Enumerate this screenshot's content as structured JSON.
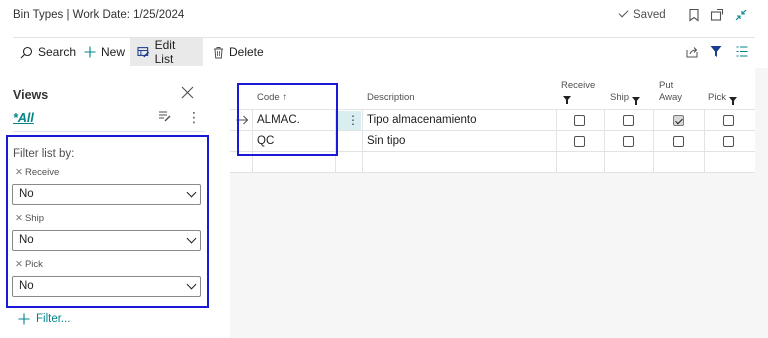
{
  "header": {
    "title": "Bin Types | Work Date: 1/25/2024",
    "saved_label": "Saved"
  },
  "actions": {
    "search": "Search",
    "new": "New",
    "edit_list": "Edit List",
    "delete": "Delete"
  },
  "views": {
    "title": "Views",
    "all_label": "*All",
    "filter_heading": "Filter list by:",
    "filters": [
      {
        "label": "Receive",
        "value": "No"
      },
      {
        "label": "Ship",
        "value": "No"
      },
      {
        "label": "Pick",
        "value": "No"
      }
    ],
    "add_filter": "Filter..."
  },
  "table": {
    "columns": {
      "code": "Code ↑",
      "description": "Description",
      "receive": "Receive",
      "ship": "Ship",
      "put_away_line1": "Put",
      "put_away_line2": "Away",
      "pick": "Pick"
    },
    "rows": [
      {
        "code": "ALMAC.",
        "description": "Tipo almacenamiento",
        "receive": false,
        "ship": false,
        "put_away": true,
        "pick": false
      },
      {
        "code": "QC",
        "description": "Sin tipo",
        "receive": false,
        "ship": false,
        "put_away": false,
        "pick": false
      }
    ]
  },
  "colors": {
    "accent": "#008489",
    "highlight_border": "#1a1ad6",
    "active_row_menu": "#d8eef0"
  },
  "icons": [
    "search-icon",
    "plus-icon",
    "edit-list-icon",
    "trash-icon",
    "bookmark-icon",
    "open-new-window-icon",
    "collapse-icon",
    "share-icon",
    "filter-icon",
    "list-view-icon",
    "close-icon",
    "edit-view-icon",
    "more-icon",
    "arrow-right-icon",
    "check-icon"
  ]
}
